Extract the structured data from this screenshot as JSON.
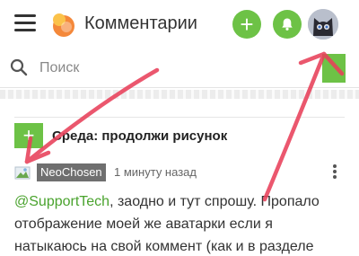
{
  "header": {
    "title": "Комментарии",
    "add_label": "+",
    "icons": {
      "menu": "hamburger-icon",
      "logo": "app-logo",
      "bell": "bell-icon",
      "avatar": "cat-avatar"
    }
  },
  "search": {
    "placeholder": "Поиск",
    "icon": "search-icon"
  },
  "post": {
    "add_label": "+",
    "title": "Среда: продолжи рисунок"
  },
  "comment": {
    "author": "NeoChosen",
    "time": "1 минуту назад",
    "mention": "@SupportTech",
    "text": ", заодно и тут спрошу. Пропало отображение моей же аватарки если я натыкаюсь на свой коммент (как и в разделе"
  },
  "colors": {
    "accent": "#6dc246",
    "annotation": "#e8405a"
  }
}
